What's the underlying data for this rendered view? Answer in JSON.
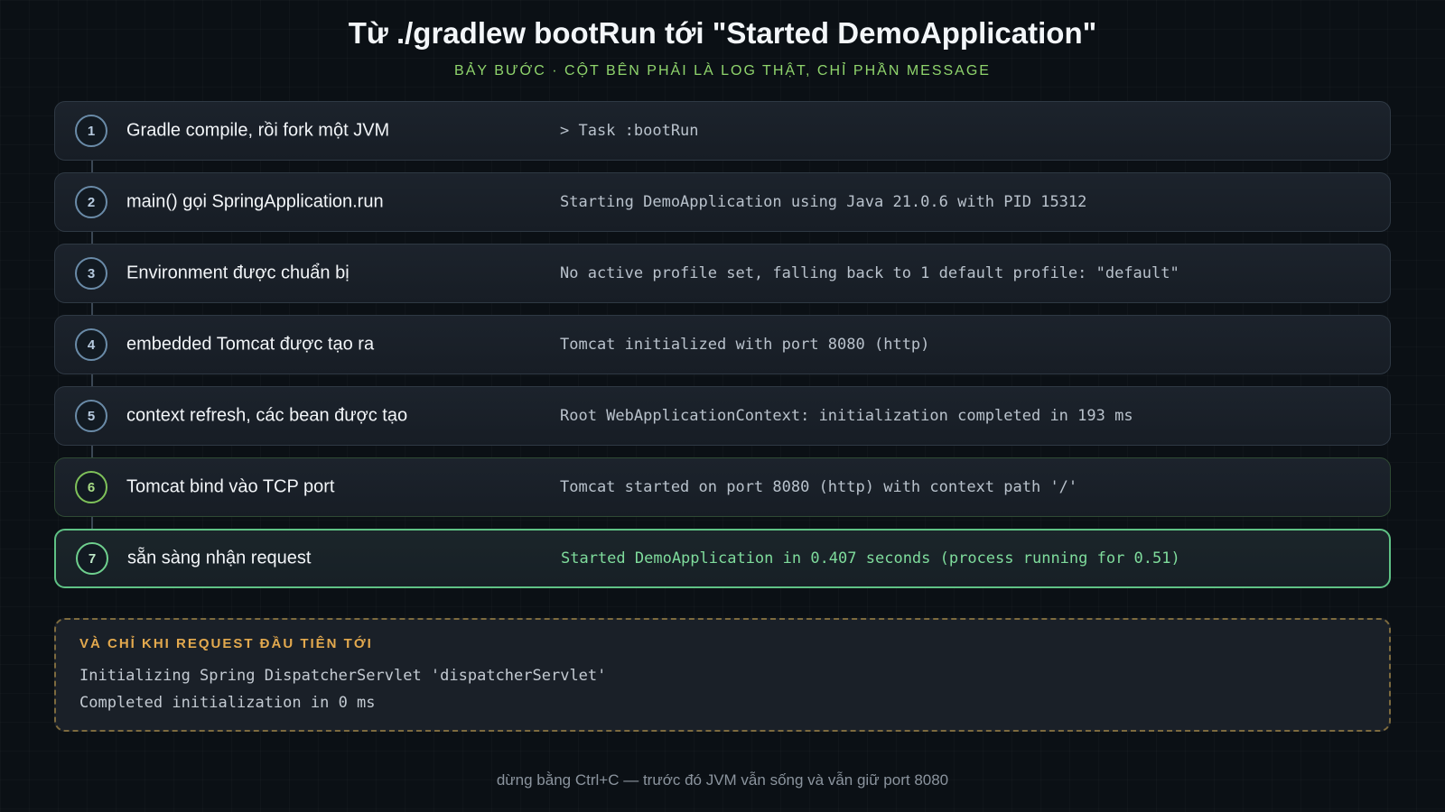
{
  "header": {
    "title": "Từ ./gradlew bootRun tới \"Started DemoApplication\"",
    "subtitle": "BẢY BƯỚC · CỘT BÊN PHẢI LÀ LOG THẬT, CHỈ PHẦN MESSAGE"
  },
  "steps": [
    {
      "number": "1",
      "label": "Gradle compile, rồi fork một JVM",
      "log": "> Task :bootRun"
    },
    {
      "number": "2",
      "label": "main() gọi SpringApplication.run",
      "log": "Starting DemoApplication using Java 21.0.6 with PID 15312"
    },
    {
      "number": "3",
      "label": "Environment được chuẩn bị",
      "log": "No active profile set, falling back to 1 default profile: \"default\""
    },
    {
      "number": "4",
      "label": "embedded Tomcat được tạo ra",
      "log": "Tomcat initialized with port 8080 (http)"
    },
    {
      "number": "5",
      "label": "context refresh, các bean được tạo",
      "log": "Root WebApplicationContext: initialization completed in 193 ms"
    },
    {
      "number": "6",
      "label": "Tomcat bind vào TCP port",
      "log": "Tomcat started on port 8080 (http) with context path '/'"
    },
    {
      "number": "7",
      "label": "sẵn sàng nhận request",
      "log": "Started DemoApplication in 0.407 seconds (process running for 0.51)"
    }
  ],
  "first_request": {
    "title": "VÀ CHỈ KHI REQUEST ĐẦU TIÊN TỚI",
    "lines": [
      "Initializing Spring DispatcherServlet 'dispatcherServlet'",
      "Completed initialization in 0 ms"
    ]
  },
  "footer": "dừng bằng Ctrl+C — trước đó JVM vẫn sống và vẫn giữ port 8080",
  "colors": {
    "background": "#0b1015",
    "accent_green": "#8fd46c",
    "success_green": "#7fdc9c",
    "warning_amber": "#e3a94e"
  }
}
